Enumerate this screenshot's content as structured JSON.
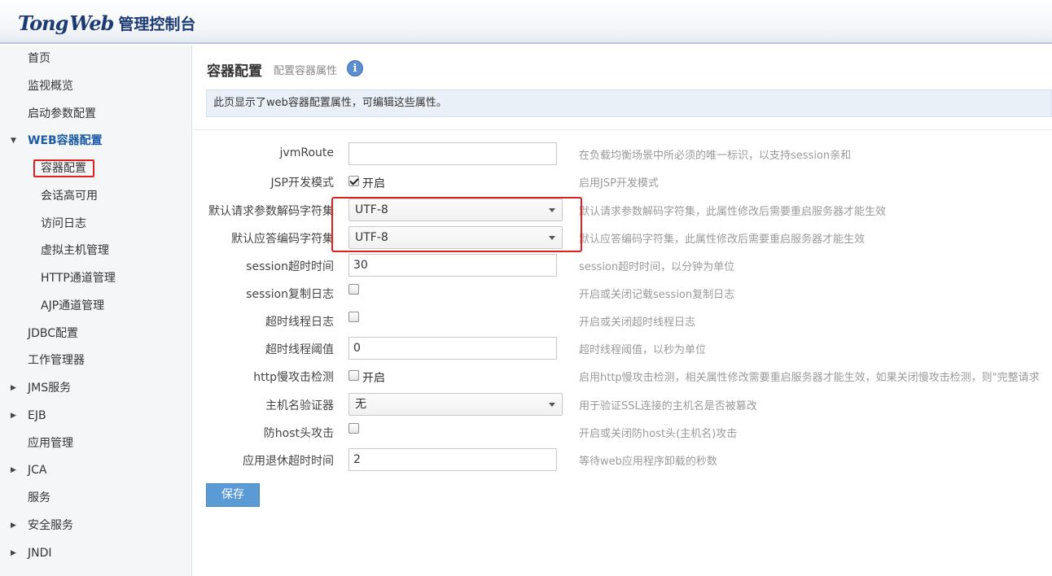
{
  "header": {
    "logo_tong": "Tong",
    "logo_web": "Web",
    "logo_sub": "管理控制台"
  },
  "sidebar": {
    "items": [
      {
        "label": "首页"
      },
      {
        "label": "监视概览"
      },
      {
        "label": "启动参数配置"
      },
      {
        "label": "WEB容器配置",
        "expanded": true
      },
      {
        "label": "容器配置",
        "selected": true
      },
      {
        "label": "会话高可用"
      },
      {
        "label": "访问日志"
      },
      {
        "label": "虚拟主机管理"
      },
      {
        "label": "HTTP通道管理"
      },
      {
        "label": "AJP通道管理"
      },
      {
        "label": "JDBC配置"
      },
      {
        "label": "工作管理器"
      },
      {
        "label": "JMS服务",
        "collapsed": true
      },
      {
        "label": "EJB",
        "collapsed": true
      },
      {
        "label": "应用管理"
      },
      {
        "label": "JCA",
        "collapsed": true
      },
      {
        "label": "服务"
      },
      {
        "label": "安全服务",
        "collapsed": true
      },
      {
        "label": "JNDI",
        "collapsed": true
      }
    ]
  },
  "main": {
    "title": "容器配置",
    "subtitle": "配置容器属性",
    "info_icon": "i",
    "notice": "此页显示了web容器配置属性，可编辑这些属性。",
    "fields": [
      {
        "label": "jvmRoute",
        "value": "",
        "help": "在负载均衡场景中所必须的唯一标识，以支持session亲和"
      },
      {
        "label": "JSP开发模式",
        "checked": true,
        "check_label": "开启",
        "help": "启用JSP开发模式"
      },
      {
        "label": "默认请求参数解码字符集",
        "value": "UTF-8",
        "help": "默认请求参数解码字符集，此属性修改后需要重启服务器才能生效"
      },
      {
        "label": "默认应答编码字符集",
        "value": "UTF-8",
        "help": "默认应答编码字符集，此属性修改后需要重启服务器才能生效"
      },
      {
        "label": "session超时时间",
        "value": "30",
        "help": "session超时时间，以分钟为单位"
      },
      {
        "label": "session复制日志",
        "checked": false,
        "help": "开启或关闭记载session复制日志"
      },
      {
        "label": "超时线程日志",
        "checked": false,
        "help": "开启或关闭超时线程日志"
      },
      {
        "label": "超时线程阈值",
        "value": "0",
        "help": "超时线程阈值，以秒为单位"
      },
      {
        "label": "http慢攻击检测",
        "checked": false,
        "check_label": "开启",
        "help": "启用http慢攻击检测，相关属性修改需要重启服务器才能生效，如果关闭慢攻击检测，则\"完整请求"
      },
      {
        "label": "主机名验证器",
        "value": "无",
        "help": "用于验证SSL连接的主机名是否被篡改"
      },
      {
        "label": "防host头攻击",
        "checked": false,
        "help": "开启或关闭防host头(主机名)攻击"
      },
      {
        "label": "应用退休超时时间",
        "value": "2",
        "help": "等待web应用程序卸载的秒数"
      }
    ],
    "save_label": "保存"
  },
  "colors": {
    "accent": "#5b9bd5",
    "highlight": "#e02020",
    "nav_active": "#1a5aa6"
  }
}
